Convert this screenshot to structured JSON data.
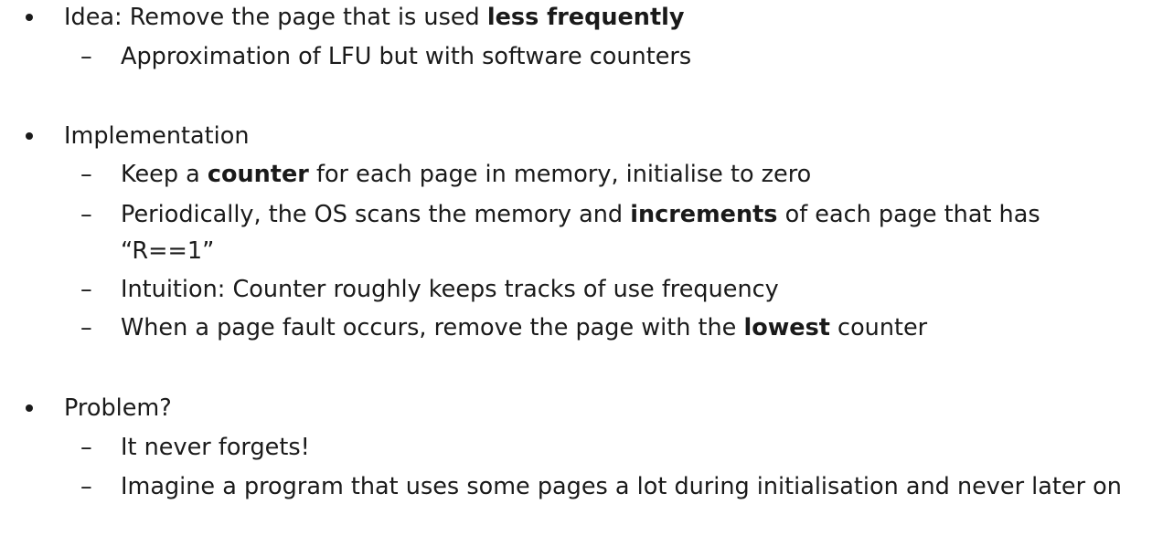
{
  "sections": [
    {
      "heading_pre": "Idea: Remove the page that is used ",
      "heading_bold": "less frequently",
      "subs": [
        {
          "pre": "Approximation of LFU but with software counters",
          "bold": "",
          "post": ""
        }
      ]
    },
    {
      "heading_pre": "Implementation",
      "heading_bold": "",
      "subs": [
        {
          "pre": "Keep a ",
          "bold": "counter",
          "post": " for each page in memory, initialise to zero"
        },
        {
          "pre": "Periodically, the OS scans the memory and ",
          "bold": "increments",
          "post": " of each page that has “R==1”"
        },
        {
          "pre": "Intuition: Counter roughly keeps tracks of use frequency",
          "bold": "",
          "post": ""
        },
        {
          "pre": "When a page fault occurs, remove the page with the ",
          "bold": "lowest",
          "post": " counter"
        }
      ]
    },
    {
      "heading_pre": "Problem?",
      "heading_bold": "",
      "subs": [
        {
          "pre": "It never forgets!",
          "bold": "",
          "post": ""
        },
        {
          "pre": "Imagine a program that uses some pages a lot during initialisation and never later on",
          "bold": "",
          "post": ""
        }
      ]
    }
  ],
  "dash_glyph": "–"
}
